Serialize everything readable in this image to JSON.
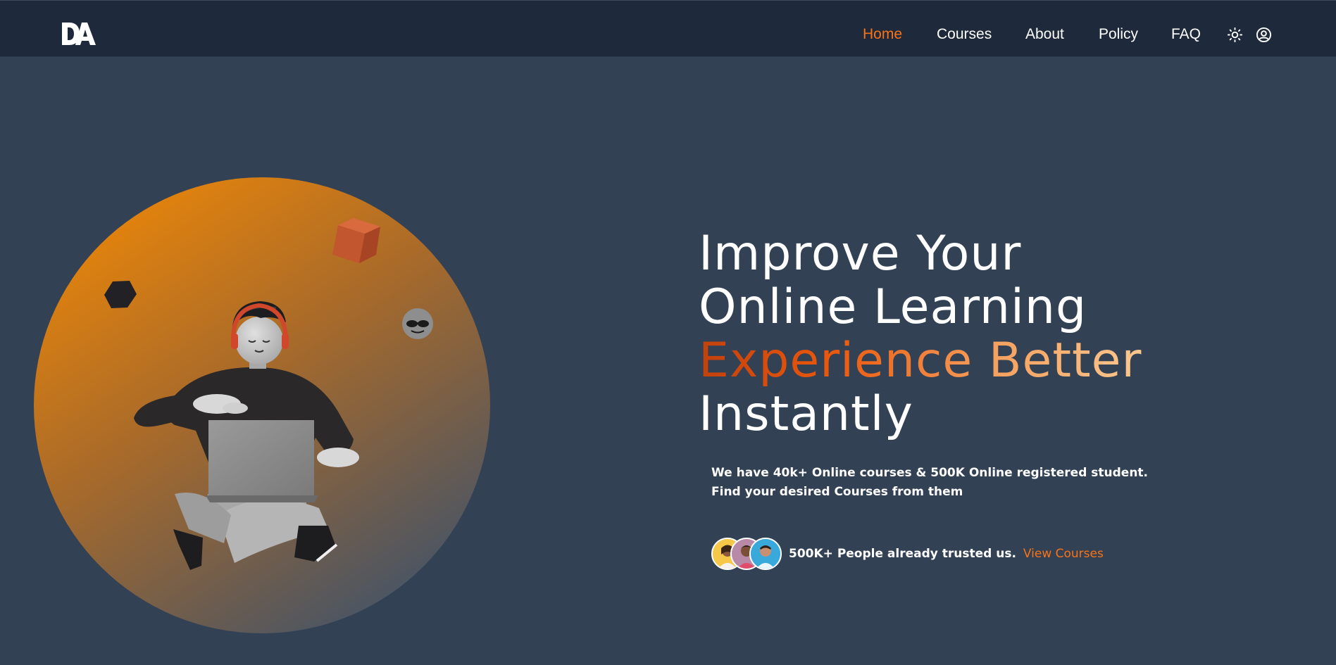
{
  "nav": {
    "logo_text": "DA",
    "links": [
      "Home",
      "Courses",
      "About",
      "Policy",
      "FAQ"
    ],
    "active_link": "Home",
    "icons": [
      "sun-icon",
      "user-circle-icon"
    ]
  },
  "hero": {
    "headline": {
      "line1": "Improve Your",
      "line2": "Online Learning",
      "line3_highlight": "Experience Better",
      "line4": "Instantly"
    },
    "description": "We have 40k+ Online courses & 500K Online registered student. Find your desired Courses from them",
    "trust_text": "500K+ People already trusted us.",
    "cta_link": "View Courses",
    "illustration": "3d-character-with-laptop"
  },
  "colors": {
    "page_bg": "#334155",
    "nav_bg": "#1e293b",
    "accent": "#f97316",
    "highlight_gradient": [
      "#c2410c",
      "#fbc78f"
    ],
    "circle_gradient": [
      "#e8850a",
      "#4b5563"
    ]
  }
}
